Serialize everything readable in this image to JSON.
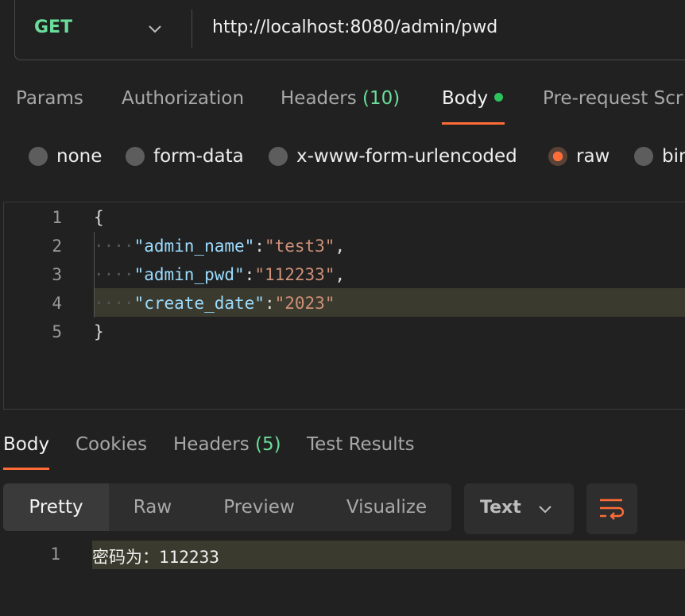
{
  "request": {
    "method": "GET",
    "url": "http://localhost:8080/admin/pwd"
  },
  "request_tabs": {
    "params": "Params",
    "authorization": "Authorization",
    "headers_label": "Headers",
    "headers_count": "(10)",
    "body": "Body",
    "prerequest": "Pre-request Scr"
  },
  "body_modes": {
    "none": "none",
    "form_data": "form-data",
    "urlencoded": "x-www-form-urlencoded",
    "raw": "raw",
    "binary": "bin",
    "selected": "raw"
  },
  "editor": {
    "line_numbers": [
      "1",
      "2",
      "3",
      "4",
      "5"
    ],
    "open_brace": "{",
    "close_brace": "}",
    "fields": [
      {
        "key": "\"admin_name\"",
        "value": "\"test3\"",
        "trail": ","
      },
      {
        "key": "\"admin_pwd\"",
        "value": "\"112233\"",
        "trail": ","
      },
      {
        "key": "\"create_date\"",
        "value": "\"2023\"",
        "trail": ""
      }
    ],
    "indent_dots": "····",
    "colon": ":"
  },
  "response_tabs": {
    "body": "Body",
    "cookies": "Cookies",
    "headers_label": "Headers",
    "headers_count": "(5)",
    "test_results": "Test Results"
  },
  "view_modes": {
    "pretty": "Pretty",
    "raw": "Raw",
    "preview": "Preview",
    "visualize": "Visualize"
  },
  "format": "Text",
  "response": {
    "line_number": "1",
    "text": "密码为：112233"
  },
  "colors": {
    "accent": "#ff6c37",
    "method_get": "#6bdd9a",
    "json_key": "#9cdcfe",
    "json_string": "#ce9178"
  }
}
